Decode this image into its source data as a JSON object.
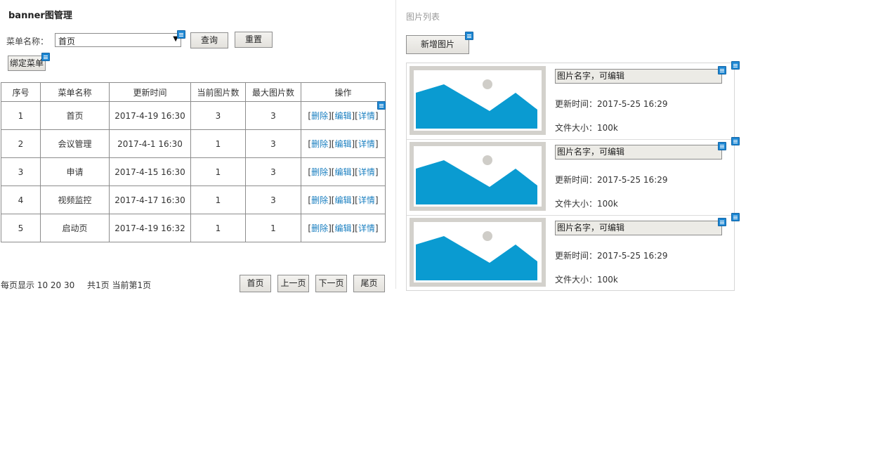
{
  "left": {
    "title": "banner图管理",
    "menu_label": "菜单名称：",
    "menu_value": "首页",
    "query_btn": "查询",
    "reset_btn": "重置",
    "bind_btn": "绑定菜单",
    "columns": [
      "序号",
      "菜单名称",
      "更新时间",
      "当前图片数",
      "最大图片数",
      "操作"
    ],
    "rows": [
      {
        "no": "1",
        "name": "首页",
        "time": "2017-4-19 16:30",
        "current": "3",
        "max": "3"
      },
      {
        "no": "2",
        "name": "会议管理",
        "time": "2017-4-1 16:30",
        "current": "1",
        "max": "3"
      },
      {
        "no": "3",
        "name": "申请",
        "time": "2017-4-15 16:30",
        "current": "1",
        "max": "3"
      },
      {
        "no": "4",
        "name": "视频监控",
        "time": "2017-4-17 16:30",
        "current": "1",
        "max": "3"
      },
      {
        "no": "5",
        "name": "启动页",
        "time": "2017-4-19 16:32",
        "current": "1",
        "max": "1"
      }
    ],
    "op_delete": "删除",
    "op_edit": "编辑",
    "op_detail": "详情",
    "pager": {
      "page_size_text": "每页显示 10 20 30",
      "summary": "共1页 当前第1页",
      "first": "首页",
      "prev": "上一页",
      "next": "下一页",
      "last": "尾页"
    }
  },
  "right": {
    "title": "图片列表",
    "add_btn": "新增图片",
    "cards": [
      {
        "name": "图片名字，可编辑",
        "updated": "更新时间：2017-5-25 16:29",
        "size": "文件大小：100k"
      },
      {
        "name": "图片名字，可编辑",
        "updated": "更新时间：2017-5-25 16:29",
        "size": "文件大小：100k"
      },
      {
        "name": "图片名字，可编辑",
        "updated": "更新时间：2017-5-25 16:29",
        "size": "文件大小：100k"
      }
    ]
  },
  "colors": {
    "accent": "#0a9bd1",
    "link": "#1a7fc0",
    "note_icon": "#1e88d4"
  }
}
